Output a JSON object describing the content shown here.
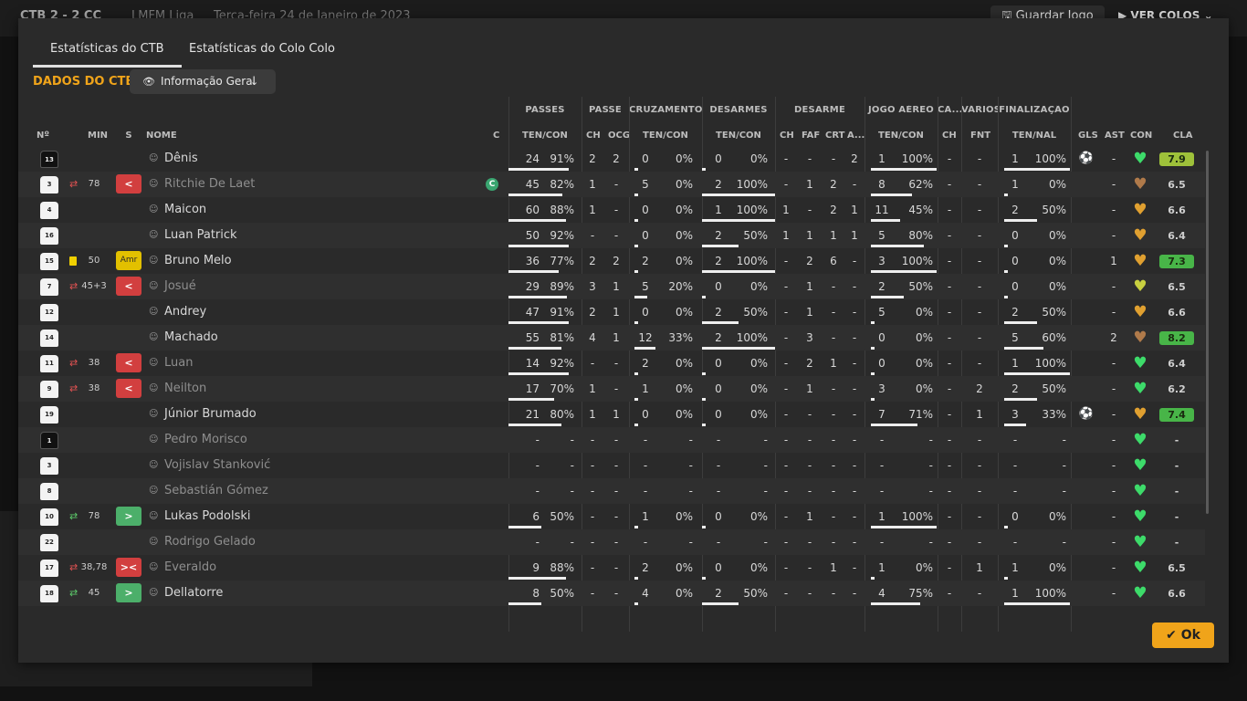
{
  "background": {
    "score": "CTB 2 - 2 CC",
    "league": "LMFM Liga",
    "date": "Terça-feira 24 de Janeiro de 2023",
    "save_label": "Guardar Jogo",
    "view_label": "VER COLOS"
  },
  "tabs": [
    "Estatísticas do CTB",
    "Estatísticas do Colo Colo"
  ],
  "section_title": "DADOS DO CTB",
  "dropdown_label": "Informação Geral",
  "groups": [
    "PASSES",
    "PASSE",
    "CRUZAMENTOS",
    "DESARMES",
    "DESARME",
    "JOGO AÉREO",
    "CA...",
    "VÁRIOS",
    "FINALIZAÇÃO"
  ],
  "headers": [
    "Nº",
    "MIN",
    "S",
    "NOME",
    "C",
    "TEN/CON",
    "CH",
    "OCG",
    "TEN/CON",
    "TEN/CON",
    "CH",
    "FAF",
    "CRT",
    "A...",
    "TEN/CON",
    "CH",
    "FNT",
    "TEN/NAL",
    "GLS",
    "AST",
    "CON",
    "CLA"
  ],
  "colors": {
    "accent": "#f0a41a",
    "sub_out": "#d23f3f",
    "sub_in": "#4caf6a",
    "yellow": "#e2c000"
  },
  "players": [
    {
      "num": "13",
      "gk": true,
      "swap": "",
      "card": false,
      "min": "",
      "s": "",
      "name": "Dênis",
      "dim": false,
      "cap": "",
      "pas": [
        "24",
        "91%"
      ],
      "pb": [
        2,
        2
      ],
      "cruz": [
        "0",
        "0%"
      ],
      "des": [
        "0",
        "0%"
      ],
      "dsm": [
        "-",
        "-",
        "-",
        "2"
      ],
      "aer": [
        "1",
        "100%"
      ],
      "ca": "-",
      "fnt": "-",
      "fin": [
        "1",
        "100%"
      ],
      "gls": "⚽",
      "ast": "-",
      "con": "#3ddb6a",
      "cla": "7.9",
      "clacls": "mid"
    },
    {
      "num": "3",
      "gk": false,
      "swap": "out",
      "card": false,
      "min": "78",
      "s": "<",
      "name": "Ritchie De Laet",
      "dim": true,
      "cap": "C",
      "pas": [
        "45",
        "82%"
      ],
      "pb": [
        1,
        "-"
      ],
      "cruz": [
        "5",
        "0%"
      ],
      "des": [
        "2",
        "100%"
      ],
      "dsm": [
        "-",
        "1",
        "2",
        "-"
      ],
      "aer": [
        "8",
        "62%"
      ],
      "ca": "-",
      "fnt": "-",
      "fin": [
        "1",
        "0%"
      ],
      "gls": "",
      "ast": "-",
      "con": "#b07a4a",
      "cla": "6.5",
      "clacls": ""
    },
    {
      "num": "4",
      "gk": false,
      "swap": "",
      "card": false,
      "min": "",
      "s": "",
      "name": "Maicon",
      "dim": false,
      "cap": "",
      "pas": [
        "60",
        "88%"
      ],
      "pb": [
        1,
        "-"
      ],
      "cruz": [
        "0",
        "0%"
      ],
      "des": [
        "1",
        "100%"
      ],
      "dsm": [
        "1",
        "-",
        "2",
        "1"
      ],
      "aer": [
        "11",
        "45%"
      ],
      "ca": "-",
      "fnt": "-",
      "fin": [
        "2",
        "50%"
      ],
      "gls": "",
      "ast": "-",
      "con": "#e0a030",
      "cla": "6.6",
      "clacls": ""
    },
    {
      "num": "16",
      "gk": false,
      "swap": "",
      "card": false,
      "min": "",
      "s": "",
      "name": "Luan Patrick",
      "dim": false,
      "cap": "",
      "pas": [
        "50",
        "92%"
      ],
      "pb": [
        "-",
        "-"
      ],
      "cruz": [
        "0",
        "0%"
      ],
      "des": [
        "2",
        "50%"
      ],
      "dsm": [
        "1",
        "1",
        "1",
        "1"
      ],
      "aer": [
        "5",
        "80%"
      ],
      "ca": "-",
      "fnt": "-",
      "fin": [
        "0",
        "0%"
      ],
      "gls": "",
      "ast": "-",
      "con": "#e0a030",
      "cla": "6.4",
      "clacls": ""
    },
    {
      "num": "15",
      "gk": false,
      "swap": "",
      "card": true,
      "min": "50",
      "s": "Amr",
      "name": "Bruno Melo",
      "dim": false,
      "cap": "",
      "pas": [
        "36",
        "77%"
      ],
      "pb": [
        2,
        2
      ],
      "cruz": [
        "2",
        "0%"
      ],
      "des": [
        "2",
        "100%"
      ],
      "dsm": [
        "-",
        "2",
        "6",
        "-"
      ],
      "aer": [
        "3",
        "100%"
      ],
      "ca": "-",
      "fnt": "-",
      "fin": [
        "0",
        "0%"
      ],
      "gls": "",
      "ast": "1",
      "con": "#e0a030",
      "cla": "7.3",
      "clacls": "hi"
    },
    {
      "num": "7",
      "gk": false,
      "swap": "out",
      "card": false,
      "min": "45+3",
      "s": "<",
      "name": "Josué",
      "dim": true,
      "cap": "",
      "pas": [
        "29",
        "89%"
      ],
      "pb": [
        3,
        1
      ],
      "cruz": [
        "5",
        "20%"
      ],
      "des": [
        "0",
        "0%"
      ],
      "dsm": [
        "-",
        "1",
        "-",
        "-"
      ],
      "aer": [
        "2",
        "50%"
      ],
      "ca": "-",
      "fnt": "-",
      "fin": [
        "0",
        "0%"
      ],
      "gls": "",
      "ast": "-",
      "con": "#c8d040",
      "cla": "6.5",
      "clacls": ""
    },
    {
      "num": "12",
      "gk": false,
      "swap": "",
      "card": false,
      "min": "",
      "s": "",
      "name": "Andrey",
      "dim": false,
      "cap": "",
      "pas": [
        "47",
        "91%"
      ],
      "pb": [
        2,
        1
      ],
      "cruz": [
        "0",
        "0%"
      ],
      "des": [
        "2",
        "50%"
      ],
      "dsm": [
        "-",
        "1",
        "-",
        "-"
      ],
      "aer": [
        "5",
        "0%"
      ],
      "ca": "-",
      "fnt": "-",
      "fin": [
        "2",
        "50%"
      ],
      "gls": "",
      "ast": "-",
      "con": "#e0a030",
      "cla": "6.6",
      "clacls": ""
    },
    {
      "num": "14",
      "gk": false,
      "swap": "",
      "card": false,
      "min": "",
      "s": "",
      "name": "Machado",
      "dim": false,
      "cap": "",
      "pas": [
        "55",
        "81%"
      ],
      "pb": [
        4,
        1
      ],
      "cruz": [
        "12",
        "33%"
      ],
      "des": [
        "2",
        "100%"
      ],
      "dsm": [
        "-",
        "3",
        "-",
        "-"
      ],
      "aer": [
        "0",
        "0%"
      ],
      "ca": "-",
      "fnt": "-",
      "fin": [
        "5",
        "60%"
      ],
      "gls": "",
      "ast": "2",
      "con": "#b07a4a",
      "cla": "8.2",
      "clacls": "hi"
    },
    {
      "num": "11",
      "gk": false,
      "swap": "out",
      "card": false,
      "min": "38",
      "s": "<",
      "name": "Luan",
      "dim": true,
      "cap": "",
      "pas": [
        "14",
        "92%"
      ],
      "pb": [
        "-",
        "-"
      ],
      "cruz": [
        "2",
        "0%"
      ],
      "des": [
        "0",
        "0%"
      ],
      "dsm": [
        "-",
        "2",
        "1",
        "-"
      ],
      "aer": [
        "0",
        "0%"
      ],
      "ca": "-",
      "fnt": "-",
      "fin": [
        "1",
        "100%"
      ],
      "gls": "",
      "ast": "-",
      "con": "#3ddb6a",
      "cla": "6.4",
      "clacls": ""
    },
    {
      "num": "9",
      "gk": false,
      "swap": "out",
      "card": false,
      "min": "38",
      "s": "<",
      "name": "Neilton",
      "dim": true,
      "cap": "",
      "pas": [
        "17",
        "70%"
      ],
      "pb": [
        1,
        "-"
      ],
      "cruz": [
        "1",
        "0%"
      ],
      "des": [
        "0",
        "0%"
      ],
      "dsm": [
        "-",
        "1",
        "-",
        "-"
      ],
      "aer": [
        "3",
        "0%"
      ],
      "ca": "-",
      "fnt": "2",
      "fin": [
        "2",
        "50%"
      ],
      "gls": "",
      "ast": "-",
      "con": "#3ddb6a",
      "cla": "6.2",
      "clacls": ""
    },
    {
      "num": "19",
      "gk": false,
      "swap": "",
      "card": false,
      "min": "",
      "s": "",
      "name": "Júnior Brumado",
      "dim": false,
      "cap": "",
      "pas": [
        "21",
        "80%"
      ],
      "pb": [
        1,
        1
      ],
      "cruz": [
        "0",
        "0%"
      ],
      "des": [
        "0",
        "0%"
      ],
      "dsm": [
        "-",
        "-",
        "-",
        "-"
      ],
      "aer": [
        "7",
        "71%"
      ],
      "ca": "-",
      "fnt": "1",
      "fin": [
        "3",
        "33%"
      ],
      "gls": "⚽",
      "ast": "-",
      "con": "#e0a030",
      "cla": "7.4",
      "clacls": "hi"
    },
    {
      "num": "1",
      "gk": true,
      "swap": "",
      "card": false,
      "min": "",
      "s": "",
      "name": "Pedro Morisco",
      "dim": true,
      "cap": "",
      "pas": [
        "-",
        "-"
      ],
      "pb": [
        "-",
        "-"
      ],
      "cruz": [
        "-",
        "-"
      ],
      "des": [
        "-",
        "-"
      ],
      "dsm": [
        "-",
        "-",
        "-",
        "-"
      ],
      "aer": [
        "-",
        "-"
      ],
      "ca": "-",
      "fnt": "-",
      "fin": [
        "-",
        "-"
      ],
      "gls": "",
      "ast": "-",
      "con": "#3ddb6a",
      "cla": "-",
      "clacls": ""
    },
    {
      "num": "3",
      "gk": false,
      "swap": "",
      "card": false,
      "min": "",
      "s": "",
      "name": "Vojislav Stanković",
      "dim": true,
      "cap": "",
      "pas": [
        "-",
        "-"
      ],
      "pb": [
        "-",
        "-"
      ],
      "cruz": [
        "-",
        "-"
      ],
      "des": [
        "-",
        "-"
      ],
      "dsm": [
        "-",
        "-",
        "-",
        "-"
      ],
      "aer": [
        "-",
        "-"
      ],
      "ca": "-",
      "fnt": "-",
      "fin": [
        "-",
        "-"
      ],
      "gls": "",
      "ast": "-",
      "con": "#3ddb6a",
      "cla": "-",
      "clacls": ""
    },
    {
      "num": "8",
      "gk": false,
      "swap": "",
      "card": false,
      "min": "",
      "s": "",
      "name": "Sebastián Gómez",
      "dim": true,
      "cap": "",
      "pas": [
        "-",
        "-"
      ],
      "pb": [
        "-",
        "-"
      ],
      "cruz": [
        "-",
        "-"
      ],
      "des": [
        "-",
        "-"
      ],
      "dsm": [
        "-",
        "-",
        "-",
        "-"
      ],
      "aer": [
        "-",
        "-"
      ],
      "ca": "-",
      "fnt": "-",
      "fin": [
        "-",
        "-"
      ],
      "gls": "",
      "ast": "-",
      "con": "#3ddb6a",
      "cla": "-",
      "clacls": ""
    },
    {
      "num": "10",
      "gk": false,
      "swap": "in",
      "card": false,
      "min": "78",
      "s": ">",
      "name": "Lukas Podolski",
      "dim": false,
      "cap": "",
      "pas": [
        "6",
        "50%"
      ],
      "pb": [
        "-",
        "-"
      ],
      "cruz": [
        "1",
        "0%"
      ],
      "des": [
        "0",
        "0%"
      ],
      "dsm": [
        "-",
        "1",
        "-",
        "-"
      ],
      "aer": [
        "1",
        "100%"
      ],
      "ca": "-",
      "fnt": "-",
      "fin": [
        "0",
        "0%"
      ],
      "gls": "",
      "ast": "-",
      "con": "#3ddb6a",
      "cla": "-",
      "clacls": ""
    },
    {
      "num": "22",
      "gk": false,
      "swap": "",
      "card": false,
      "min": "",
      "s": "",
      "name": "Rodrigo Gelado",
      "dim": true,
      "cap": "",
      "pas": [
        "-",
        "-"
      ],
      "pb": [
        "-",
        "-"
      ],
      "cruz": [
        "-",
        "-"
      ],
      "des": [
        "-",
        "-"
      ],
      "dsm": [
        "-",
        "-",
        "-",
        "-"
      ],
      "aer": [
        "-",
        "-"
      ],
      "ca": "-",
      "fnt": "-",
      "fin": [
        "-",
        "-"
      ],
      "gls": "",
      "ast": "-",
      "con": "#3ddb6a",
      "cla": "-",
      "clacls": ""
    },
    {
      "num": "17",
      "gk": false,
      "swap": "out",
      "card": false,
      "min": "38,78",
      "s": "><",
      "name": "Everaldo",
      "dim": true,
      "cap": "",
      "pas": [
        "9",
        "88%"
      ],
      "pb": [
        "-",
        "-"
      ],
      "cruz": [
        "2",
        "0%"
      ],
      "des": [
        "0",
        "0%"
      ],
      "dsm": [
        "-",
        "-",
        "1",
        "-"
      ],
      "aer": [
        "1",
        "0%"
      ],
      "ca": "-",
      "fnt": "1",
      "fin": [
        "1",
        "0%"
      ],
      "gls": "",
      "ast": "-",
      "con": "#3ddb6a",
      "cla": "6.5",
      "clacls": ""
    },
    {
      "num": "18",
      "gk": false,
      "swap": "in",
      "card": false,
      "min": "45",
      "s": ">",
      "name": "Dellatorre",
      "dim": false,
      "cap": "",
      "pas": [
        "8",
        "50%"
      ],
      "pb": [
        "-",
        "-"
      ],
      "cruz": [
        "4",
        "0%"
      ],
      "des": [
        "2",
        "50%"
      ],
      "dsm": [
        "-",
        "-",
        "-",
        "-"
      ],
      "aer": [
        "4",
        "75%"
      ],
      "ca": "-",
      "fnt": "-",
      "fin": [
        "1",
        "100%"
      ],
      "gls": "",
      "ast": "-",
      "con": "#3ddb6a",
      "cla": "6.6",
      "clacls": ""
    }
  ],
  "ok_label": "Ok"
}
